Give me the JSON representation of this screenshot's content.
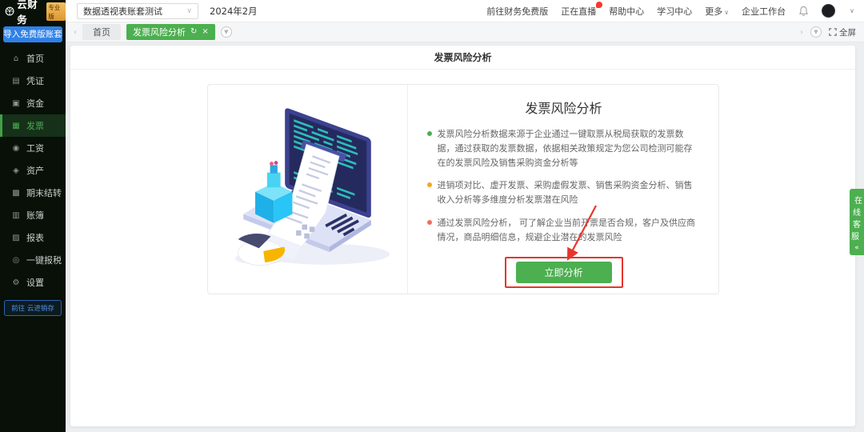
{
  "topbar": {
    "logo": {
      "text": "云财务",
      "badge": "专业版"
    },
    "account_select": {
      "value": "数据透视表账套测试"
    },
    "period": "2024年2月",
    "nav": {
      "free_version": "前往财务免费版",
      "live": "正在直播",
      "help": "帮助中心",
      "learn": "学习中心",
      "more": "更多",
      "workspace": "企业工作台"
    }
  },
  "sidebar": {
    "import_button": "导入免费版账套",
    "items": [
      {
        "label": "首页"
      },
      {
        "label": "凭证"
      },
      {
        "label": "资金"
      },
      {
        "label": "发票",
        "active": true
      },
      {
        "label": "工资"
      },
      {
        "label": "资产"
      },
      {
        "label": "期末结转"
      },
      {
        "label": "账簿"
      },
      {
        "label": "报表"
      },
      {
        "label": "一键报税"
      },
      {
        "label": "设置"
      }
    ],
    "bottom_button": "前往 云进销存"
  },
  "tabbar": {
    "home_tab": "首页",
    "active_tab": "发票风险分析",
    "fullscreen": "全屏"
  },
  "page": {
    "header": "发票风险分析"
  },
  "panel": {
    "title": "发票风险分析",
    "bullets": [
      {
        "color": "#4caf50",
        "text": "发票风险分析数据来源于企业通过一键取票从税局获取的发票数据，通过获取的发票数据，依据相关政策规定为您公司检测可能存在的发票风险及销售采购资金分析等"
      },
      {
        "color": "#f5a623",
        "text": "进销项对比、虚开发票、采购虚假发票、销售采购资金分析、销售收入分析等多维度分析发票潜在风险"
      },
      {
        "color": "#f56c5c",
        "text": "通过发票风险分析， 可了解企业当前开票是否合规，客户及供应商情况，商品明细信息，规避企业潜在的发票风险"
      }
    ],
    "cta": "立即分析"
  },
  "right_dock": {
    "label": "在线客服",
    "collapse": "«"
  },
  "colors": {
    "accent_green": "#4caf50",
    "annotation_red": "#e8352b",
    "import_blue": "#2f81e8",
    "badge_gold": "#e0a03c",
    "sidebar_dark": "#081008"
  }
}
